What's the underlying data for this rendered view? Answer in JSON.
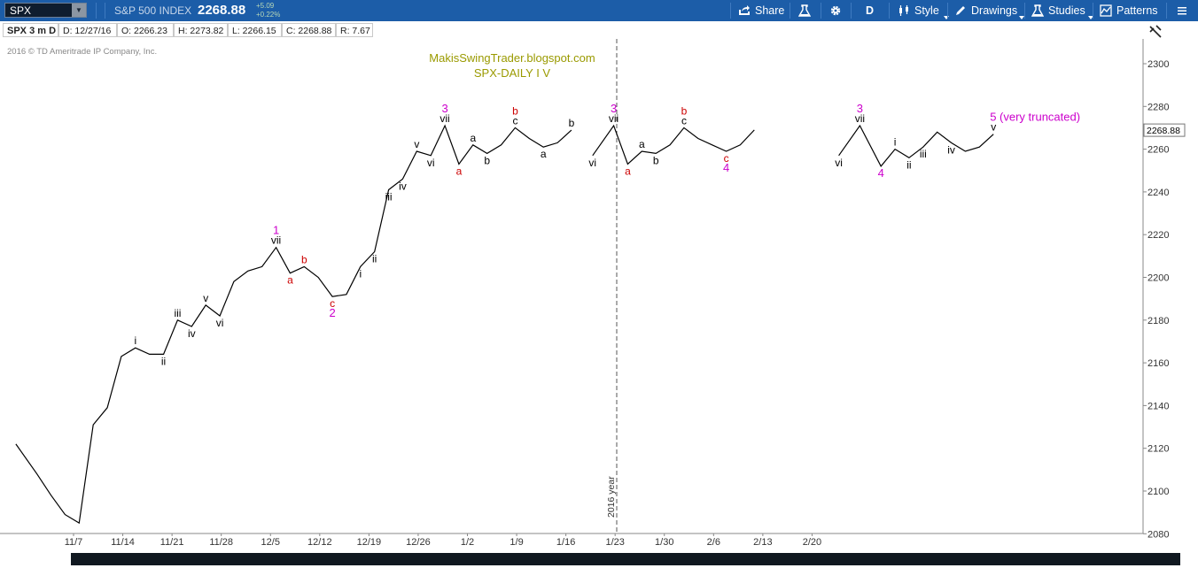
{
  "toolbar": {
    "symbol": "SPX",
    "index_name": "S&P 500 INDEX",
    "last_price": "2268.88",
    "change_abs": "+5.09",
    "change_pct": "+0.22%",
    "share_label": "Share",
    "period_label": "D",
    "style_label": "Style",
    "drawings_label": "Drawings",
    "studies_label": "Studies",
    "patterns_label": "Patterns",
    "icons": [
      "share-icon",
      "flask-icon",
      "gear-icon",
      "style-icon",
      "pencil-icon",
      "studies-flask-icon",
      "patterns-icon",
      "menu-icon"
    ]
  },
  "infobar": {
    "symbol_period": "SPX 3 m D",
    "date": "D: 12/27/16",
    "open": "O: 2266.23",
    "high": "H: 2273.82",
    "low": "L: 2266.15",
    "close": "C: 2268.88",
    "range": "R: 7.67"
  },
  "copyright": "2016 © TD Ameritrade IP Company, Inc.",
  "colors": {
    "toolbar_bg": "#1c5da8",
    "line": "#000000",
    "wave_major": "#cc00cc",
    "wave_corrective": "#cc0000",
    "watermark": "#9a9a00"
  },
  "chart_data": {
    "type": "line",
    "title": "MakisSwingTrader.blogspot.com",
    "subtitle": "SPX-DAILY  I V",
    "ylim": [
      2080,
      2310
    ],
    "y_ticks": [
      2080,
      2100,
      2120,
      2140,
      2160,
      2180,
      2200,
      2220,
      2240,
      2260,
      2280,
      2300
    ],
    "x_ticks": [
      "11/7",
      "11/14",
      "11/21",
      "11/28",
      "12/5",
      "12/12",
      "12/19",
      "12/26",
      "1/2",
      "1/9",
      "1/16",
      "1/23",
      "1/30",
      "2/6",
      "2/13",
      "2/20"
    ],
    "last_price_label": "2268.88",
    "divider_label": "2016 year",
    "series": [
      {
        "values": [
          [
            2,
            2122
          ],
          [
            5,
            2108
          ],
          [
            7,
            2098
          ],
          [
            9,
            2089
          ],
          [
            11,
            2085
          ],
          [
            13,
            2131
          ],
          [
            15,
            2139
          ],
          [
            17,
            2163
          ],
          [
            19,
            2167
          ],
          [
            21,
            2164
          ],
          [
            23,
            2164
          ],
          [
            25,
            2180
          ],
          [
            27,
            2177
          ],
          [
            29,
            2187
          ],
          [
            31,
            2182
          ],
          [
            33,
            2198
          ],
          [
            35,
            2203
          ],
          [
            37,
            2205
          ],
          [
            39,
            2214
          ],
          [
            41,
            2202
          ],
          [
            43,
            2205
          ],
          [
            45,
            2200
          ],
          [
            47,
            2191
          ],
          [
            49,
            2192
          ],
          [
            51,
            2205
          ],
          [
            53,
            2212
          ],
          [
            55,
            2241
          ],
          [
            57,
            2246
          ],
          [
            59,
            2259
          ],
          [
            61,
            2257
          ],
          [
            63,
            2271
          ],
          [
            65,
            2253
          ],
          [
            67,
            2262
          ],
          [
            69,
            2258
          ],
          [
            71,
            2262
          ],
          [
            73,
            2270
          ],
          [
            75,
            2265
          ],
          [
            77,
            2261
          ],
          [
            79,
            2263
          ],
          [
            81,
            2268.9
          ]
        ]
      },
      {
        "values": [
          [
            84,
            2257
          ],
          [
            87,
            2271
          ],
          [
            89,
            2253
          ],
          [
            91,
            2259
          ],
          [
            93,
            2258
          ],
          [
            95,
            2262
          ],
          [
            97,
            2270
          ],
          [
            99,
            2265
          ],
          [
            101,
            2262
          ],
          [
            103,
            2259
          ],
          [
            105,
            2262
          ],
          [
            107,
            2269
          ]
        ]
      },
      {
        "values": [
          [
            119,
            2257
          ],
          [
            122,
            2271
          ],
          [
            125,
            2252
          ],
          [
            127,
            2260
          ],
          [
            129,
            2256
          ],
          [
            131,
            2261
          ],
          [
            133,
            2268
          ],
          [
            135,
            2263
          ],
          [
            137,
            2259
          ],
          [
            139,
            2261
          ],
          [
            141,
            2267
          ]
        ]
      }
    ],
    "wave_labels": [
      {
        "t": "i",
        "x": 19,
        "y": 2167,
        "c": "k"
      },
      {
        "t": "ii",
        "x": 23,
        "y": 2164,
        "c": "k"
      },
      {
        "t": "iii",
        "x": 25,
        "y": 2180,
        "c": "k"
      },
      {
        "t": "iv",
        "x": 27,
        "y": 2177,
        "c": "k"
      },
      {
        "t": "v",
        "x": 29,
        "y": 2187,
        "c": "k"
      },
      {
        "t": "vi",
        "x": 31,
        "y": 2182,
        "c": "k"
      },
      {
        "t": "vii",
        "x": 39,
        "y": 2214,
        "c": "k"
      },
      {
        "t": "1",
        "x": 39,
        "y": 2214,
        "c": "m"
      },
      {
        "t": "a",
        "x": 41,
        "y": 2202,
        "c": "r"
      },
      {
        "t": "b",
        "x": 43,
        "y": 2205,
        "c": "r"
      },
      {
        "t": "c",
        "x": 47,
        "y": 2191,
        "c": "r"
      },
      {
        "t": "2",
        "x": 47,
        "y": 2191,
        "c": "m"
      },
      {
        "t": "i",
        "x": 51,
        "y": 2205,
        "c": "k"
      },
      {
        "t": "ii",
        "x": 53,
        "y": 2212,
        "c": "k"
      },
      {
        "t": "iii",
        "x": 55,
        "y": 2241,
        "c": "k"
      },
      {
        "t": "iv",
        "x": 57,
        "y": 2246,
        "c": "k"
      },
      {
        "t": "v",
        "x": 59,
        "y": 2259,
        "c": "k"
      },
      {
        "t": "vi",
        "x": 61,
        "y": 2257,
        "c": "k"
      },
      {
        "t": "vii",
        "x": 63,
        "y": 2271,
        "c": "k"
      },
      {
        "t": "3",
        "x": 63,
        "y": 2271,
        "c": "m"
      },
      {
        "t": "a",
        "x": 65,
        "y": 2253,
        "c": "r"
      },
      {
        "t": "a",
        "x": 67,
        "y": 2262,
        "c": "k"
      },
      {
        "t": "b",
        "x": 69,
        "y": 2258,
        "c": "k"
      },
      {
        "t": "c",
        "x": 73,
        "y": 2270,
        "c": "k"
      },
      {
        "t": "b",
        "x": 73,
        "y": 2270,
        "c": "r"
      },
      {
        "t": "a",
        "x": 77,
        "y": 2261,
        "c": "k"
      },
      {
        "t": "b",
        "x": 81,
        "y": 2268.9,
        "c": "k"
      },
      {
        "t": "vi",
        "x": 84,
        "y": 2257,
        "c": "k"
      },
      {
        "t": "vii",
        "x": 87,
        "y": 2271,
        "c": "k"
      },
      {
        "t": "3",
        "x": 87,
        "y": 2271,
        "c": "m"
      },
      {
        "t": "a",
        "x": 89,
        "y": 2253,
        "c": "r"
      },
      {
        "t": "a",
        "x": 91,
        "y": 2259,
        "c": "k"
      },
      {
        "t": "b",
        "x": 93,
        "y": 2258,
        "c": "k"
      },
      {
        "t": "c",
        "x": 97,
        "y": 2270,
        "c": "k"
      },
      {
        "t": "b",
        "x": 97,
        "y": 2270,
        "c": "r"
      },
      {
        "t": "c",
        "x": 103,
        "y": 2259,
        "c": "r"
      },
      {
        "t": "4",
        "x": 103,
        "y": 2259,
        "c": "m"
      },
      {
        "t": "vi",
        "x": 119,
        "y": 2257,
        "c": "k"
      },
      {
        "t": "vii",
        "x": 122,
        "y": 2271,
        "c": "k"
      },
      {
        "t": "3",
        "x": 122,
        "y": 2271,
        "c": "m"
      },
      {
        "t": "4",
        "x": 125,
        "y": 2252,
        "c": "m"
      },
      {
        "t": "i",
        "x": 127,
        "y": 2260,
        "c": "k"
      },
      {
        "t": "ii",
        "x": 129,
        "y": 2256,
        "c": "k"
      },
      {
        "t": "iii",
        "x": 131,
        "y": 2261,
        "c": "k"
      },
      {
        "t": "iv",
        "x": 135,
        "y": 2263,
        "c": "k"
      },
      {
        "t": "v",
        "x": 141,
        "y": 2267,
        "c": "k"
      },
      {
        "t": "5 (very truncated)",
        "x": 141,
        "y": 2267,
        "c": "m"
      }
    ]
  }
}
